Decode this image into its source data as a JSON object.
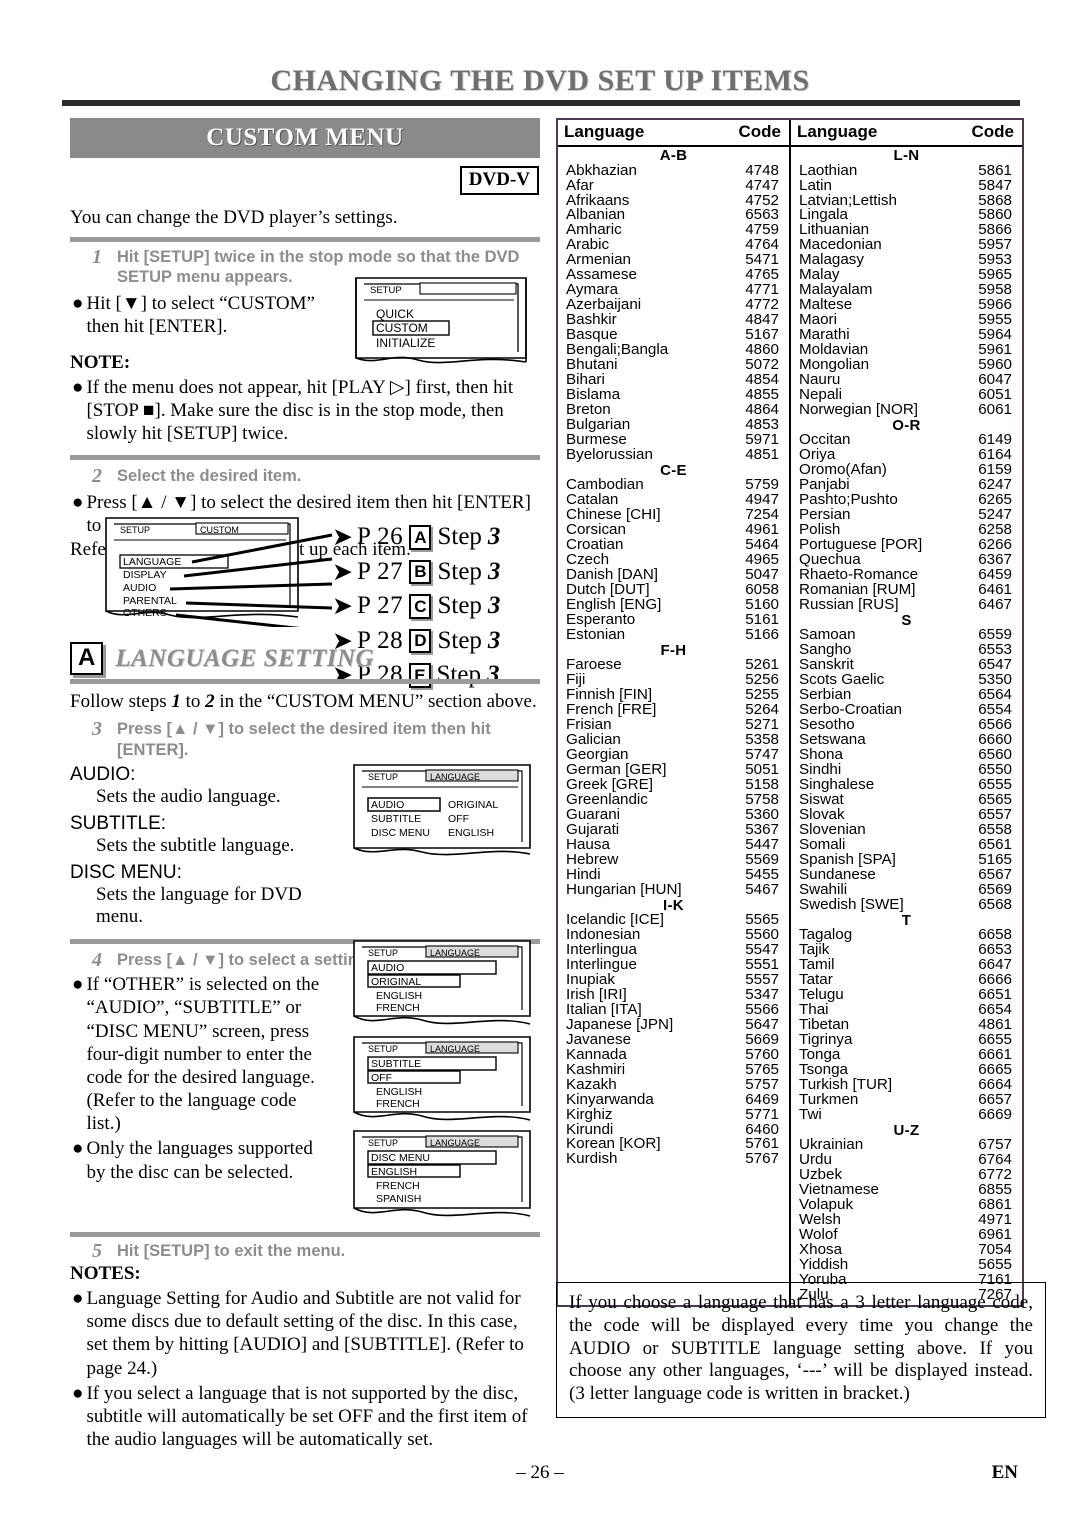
{
  "page": {
    "title": "CHANGING THE DVD SET UP ITEMS",
    "number": "– 26 –",
    "lang_mark": "EN"
  },
  "custom_menu": {
    "banner": "CUSTOM MENU",
    "badge": "DVD-V",
    "intro": "You can change the DVD player’s settings.",
    "step1": {
      "num": "1",
      "text": "Hit [SETUP] twice in the stop mode so that the DVD SETUP menu appears."
    },
    "bullet1": "Hit [▼] to select “CUSTOM” then hit [ENTER].",
    "note_heading": "NOTE:",
    "note1": "If the menu does not appear, hit [PLAY ▷] first, then hit [STOP ■]. Make sure the disc is in the stop mode, then slowly hit [SETUP] twice.",
    "step2": {
      "num": "2",
      "text": "Select the desired item."
    },
    "bullet2": "Press [▲ / ▼] to select the desired item then hit [ENTER] to confirm.",
    "refer": "Refer to the pages below to set up each item.",
    "osd_setup": {
      "header_left": "SETUP",
      "items": [
        "QUICK",
        "CUSTOM",
        "INITIALIZE"
      ],
      "highlighted": "CUSTOM"
    },
    "osd_custom": {
      "header_left": "SETUP",
      "header_right": "CUSTOM",
      "items": [
        "LANGUAGE",
        "DISPLAY",
        "AUDIO",
        "PARENTAL",
        "OTHERS"
      ],
      "highlighted": "LANGUAGE"
    },
    "page_refs": [
      {
        "page": "P 26",
        "letter": "A",
        "step": "Step",
        "num": "3"
      },
      {
        "page": "P 27",
        "letter": "B",
        "step": "Step",
        "num": "3"
      },
      {
        "page": "P 27",
        "letter": "C",
        "step": "Step",
        "num": "3"
      },
      {
        "page": "P 28",
        "letter": "D",
        "step": "Step",
        "num": "3"
      },
      {
        "page": "P 28",
        "letter": "E",
        "step": "Step",
        "num": "3"
      }
    ]
  },
  "language_setting": {
    "letter": "A",
    "title": "LANGUAGE SETTING",
    "follow": "Follow steps 1 to 2 in the “CUSTOM MENU” section above.",
    "follow_pre": "Follow steps ",
    "follow_n1": "1",
    "follow_mid": " to ",
    "follow_n2": "2",
    "follow_post": " in the “CUSTOM MENU” section above.",
    "step3": {
      "num": "3",
      "text": "Press [▲ / ▼] to select the desired item then hit [ENTER]."
    },
    "defs": [
      {
        "term": "AUDIO:",
        "desc": "Sets the audio language."
      },
      {
        "term": "SUBTITLE:",
        "desc": "Sets the subtitle language."
      },
      {
        "term": "DISC MENU:",
        "desc": "Sets the language for DVD menu."
      }
    ],
    "osd_language": {
      "header_left": "SETUP",
      "header_right": "LANGUAGE",
      "rows": [
        {
          "name": "AUDIO",
          "value": "ORIGINAL"
        },
        {
          "name": "SUBTITLE",
          "value": "OFF"
        },
        {
          "name": "DISC MENU",
          "value": "ENGLISH"
        }
      ],
      "highlighted": "AUDIO"
    },
    "step4": {
      "num": "4",
      "text": "Press [▲ / ▼] to select a setting then hit [ENTER]."
    },
    "bullet4a": "If “OTHER” is selected on the “AUDIO”, “SUBTITLE” or “DISC MENU” screen, press four-digit number to enter the code for the desired language. (Refer to the language code list.)",
    "bullet4b": "Only the languages supported by the disc can be selected.",
    "osd_audio": {
      "header_left": "SETUP",
      "header_right": "LANGUAGE",
      "title_row": "AUDIO",
      "items": [
        "ORIGINAL",
        "ENGLISH",
        "FRENCH"
      ],
      "highlighted": "ORIGINAL"
    },
    "osd_subtitle": {
      "header_left": "SETUP",
      "header_right": "LANGUAGE",
      "title_row": "SUBTITLE",
      "items": [
        "OFF",
        "ENGLISH",
        "FRENCH"
      ],
      "highlighted": "OFF"
    },
    "osd_discmenu": {
      "header_left": "SETUP",
      "header_right": "LANGUAGE",
      "title_row": "DISC MENU",
      "items": [
        "ENGLISH",
        "FRENCH",
        "SPANISH"
      ],
      "highlighted": "ENGLISH"
    },
    "step5": {
      "num": "5",
      "text": "Hit [SETUP] to exit the menu."
    },
    "notes_heading": "NOTES:",
    "note_a": "Language Setting for Audio and Subtitle are not valid for some discs due to default setting of the disc. In this case, set them by hitting [AUDIO] and [SUBTITLE]. (Refer to page 24.)",
    "note_b": "If you select a language that is not supported by the disc, subtitle will automatically be set OFF and the first item of the audio languages will be automatically set."
  },
  "code_table": {
    "headers": {
      "language": "Language",
      "code": "Code"
    },
    "left": [
      {
        "group": "A-B"
      },
      {
        "name": "Abkhazian",
        "code": "4748"
      },
      {
        "name": "Afar",
        "code": "4747"
      },
      {
        "name": "Afrikaans",
        "code": "4752"
      },
      {
        "name": "Albanian",
        "code": "6563"
      },
      {
        "name": "Amharic",
        "code": "4759"
      },
      {
        "name": "Arabic",
        "code": "4764"
      },
      {
        "name": "Armenian",
        "code": "5471"
      },
      {
        "name": "Assamese",
        "code": "4765"
      },
      {
        "name": "Aymara",
        "code": "4771"
      },
      {
        "name": "Azerbaijani",
        "code": "4772"
      },
      {
        "name": "Bashkir",
        "code": "4847"
      },
      {
        "name": "Basque",
        "code": "5167"
      },
      {
        "name": "Bengali;Bangla",
        "code": "4860"
      },
      {
        "name": "Bhutani",
        "code": "5072"
      },
      {
        "name": "Bihari",
        "code": "4854"
      },
      {
        "name": "Bislama",
        "code": "4855"
      },
      {
        "name": "Breton",
        "code": "4864"
      },
      {
        "name": "Bulgarian",
        "code": "4853"
      },
      {
        "name": "Burmese",
        "code": "5971"
      },
      {
        "name": "Byelorussian",
        "code": "4851"
      },
      {
        "group": "C-E"
      },
      {
        "name": "Cambodian",
        "code": "5759"
      },
      {
        "name": "Catalan",
        "code": "4947"
      },
      {
        "name": "Chinese [CHI]",
        "code": "7254"
      },
      {
        "name": "Corsican",
        "code": "4961"
      },
      {
        "name": "Croatian",
        "code": "5464"
      },
      {
        "name": "Czech",
        "code": "4965"
      },
      {
        "name": "Danish [DAN]",
        "code": "5047"
      },
      {
        "name": "Dutch [DUT]",
        "code": "6058"
      },
      {
        "name": "English [ENG]",
        "code": "5160"
      },
      {
        "name": "Esperanto",
        "code": "5161"
      },
      {
        "name": "Estonian",
        "code": "5166"
      },
      {
        "group": "F-H"
      },
      {
        "name": "Faroese",
        "code": "5261"
      },
      {
        "name": "Fiji",
        "code": "5256"
      },
      {
        "name": "Finnish [FIN]",
        "code": "5255"
      },
      {
        "name": "French [FRE]",
        "code": "5264"
      },
      {
        "name": "Frisian",
        "code": "5271"
      },
      {
        "name": "Galician",
        "code": "5358"
      },
      {
        "name": "Georgian",
        "code": "5747"
      },
      {
        "name": "German [GER]",
        "code": "5051"
      },
      {
        "name": "Greek [GRE]",
        "code": "5158"
      },
      {
        "name": "Greenlandic",
        "code": "5758"
      },
      {
        "name": "Guarani",
        "code": "5360"
      },
      {
        "name": "Gujarati",
        "code": "5367"
      },
      {
        "name": "Hausa",
        "code": "5447"
      },
      {
        "name": "Hebrew",
        "code": "5569"
      },
      {
        "name": "Hindi",
        "code": "5455"
      },
      {
        "name": "Hungarian [HUN]",
        "code": "5467"
      },
      {
        "group": "I-K"
      },
      {
        "name": "Icelandic [ICE]",
        "code": "5565"
      },
      {
        "name": "Indonesian",
        "code": "5560"
      },
      {
        "name": "Interlingua",
        "code": "5547"
      },
      {
        "name": "Interlingue",
        "code": "5551"
      },
      {
        "name": "Inupiak",
        "code": "5557"
      },
      {
        "name": "Irish [IRI]",
        "code": "5347"
      },
      {
        "name": "Italian [ITA]",
        "code": "5566"
      },
      {
        "name": "Japanese [JPN]",
        "code": "5647"
      },
      {
        "name": "Javanese",
        "code": "5669"
      },
      {
        "name": "Kannada",
        "code": "5760"
      },
      {
        "name": "Kashmiri",
        "code": "5765"
      },
      {
        "name": "Kazakh",
        "code": "5757"
      },
      {
        "name": "Kinyarwanda",
        "code": "6469"
      },
      {
        "name": "Kirghiz",
        "code": "5771"
      },
      {
        "name": "Kirundi",
        "code": "6460"
      },
      {
        "name": "Korean [KOR]",
        "code": "5761"
      },
      {
        "name": "Kurdish",
        "code": "5767"
      }
    ],
    "right": [
      {
        "group": "L-N"
      },
      {
        "name": "Laothian",
        "code": "5861"
      },
      {
        "name": "Latin",
        "code": "5847"
      },
      {
        "name": "Latvian;Lettish",
        "code": "5868"
      },
      {
        "name": "Lingala",
        "code": "5860"
      },
      {
        "name": "Lithuanian",
        "code": "5866"
      },
      {
        "name": "Macedonian",
        "code": "5957"
      },
      {
        "name": "Malagasy",
        "code": "5953"
      },
      {
        "name": "Malay",
        "code": "5965"
      },
      {
        "name": "Malayalam",
        "code": "5958"
      },
      {
        "name": "Maltese",
        "code": "5966"
      },
      {
        "name": "Maori",
        "code": "5955"
      },
      {
        "name": "Marathi",
        "code": "5964"
      },
      {
        "name": "Moldavian",
        "code": "5961"
      },
      {
        "name": "Mongolian",
        "code": "5960"
      },
      {
        "name": "Nauru",
        "code": "6047"
      },
      {
        "name": "Nepali",
        "code": "6051"
      },
      {
        "name": "Norwegian [NOR]",
        "code": "6061"
      },
      {
        "group": "O-R"
      },
      {
        "name": "Occitan",
        "code": "6149"
      },
      {
        "name": "Oriya",
        "code": "6164"
      },
      {
        "name": "Oromo(Afan)",
        "code": "6159"
      },
      {
        "name": "Panjabi",
        "code": "6247"
      },
      {
        "name": "Pashto;Pushto",
        "code": "6265"
      },
      {
        "name": "Persian",
        "code": "5247"
      },
      {
        "name": "Polish",
        "code": "6258"
      },
      {
        "name": "Portuguese [POR]",
        "code": "6266"
      },
      {
        "name": "Quechua",
        "code": "6367"
      },
      {
        "name": "Rhaeto-Romance",
        "code": "6459"
      },
      {
        "name": "Romanian [RUM]",
        "code": "6461"
      },
      {
        "name": "Russian [RUS]",
        "code": "6467"
      },
      {
        "group": "S"
      },
      {
        "name": "Samoan",
        "code": "6559"
      },
      {
        "name": "Sangho",
        "code": "6553"
      },
      {
        "name": "Sanskrit",
        "code": "6547"
      },
      {
        "name": "Scots Gaelic",
        "code": "5350"
      },
      {
        "name": "Serbian",
        "code": "6564"
      },
      {
        "name": "Serbo-Croatian",
        "code": "6554"
      },
      {
        "name": "Sesotho",
        "code": "6566"
      },
      {
        "name": "Setswana",
        "code": "6660"
      },
      {
        "name": "Shona",
        "code": "6560"
      },
      {
        "name": "Sindhi",
        "code": "6550"
      },
      {
        "name": "Singhalese",
        "code": "6555"
      },
      {
        "name": "Siswat",
        "code": "6565"
      },
      {
        "name": "Slovak",
        "code": "6557"
      },
      {
        "name": "Slovenian",
        "code": "6558"
      },
      {
        "name": "Somali",
        "code": "6561"
      },
      {
        "name": "Spanish [SPA]",
        "code": "5165"
      },
      {
        "name": "Sundanese",
        "code": "6567"
      },
      {
        "name": "Swahili",
        "code": "6569"
      },
      {
        "name": "Swedish [SWE]",
        "code": "6568"
      },
      {
        "group": "T"
      },
      {
        "name": "Tagalog",
        "code": "6658"
      },
      {
        "name": "Tajik",
        "code": "6653"
      },
      {
        "name": "Tamil",
        "code": "6647"
      },
      {
        "name": "Tatar",
        "code": "6666"
      },
      {
        "name": "Telugu",
        "code": "6651"
      },
      {
        "name": "Thai",
        "code": "6654"
      },
      {
        "name": "Tibetan",
        "code": "4861"
      },
      {
        "name": "Tigrinya",
        "code": "6655"
      },
      {
        "name": "Tonga",
        "code": "6661"
      },
      {
        "name": "Tsonga",
        "code": "6665"
      },
      {
        "name": "Turkish [TUR]",
        "code": "6664"
      },
      {
        "name": "Turkmen",
        "code": "6657"
      },
      {
        "name": "Twi",
        "code": "6669"
      },
      {
        "group": "U-Z"
      },
      {
        "name": "Ukrainian",
        "code": "6757"
      },
      {
        "name": "Urdu",
        "code": "6764"
      },
      {
        "name": "Uzbek",
        "code": "6772"
      },
      {
        "name": "Vietnamese",
        "code": "6855"
      },
      {
        "name": "Volapuk",
        "code": "6861"
      },
      {
        "name": "Welsh",
        "code": "4971"
      },
      {
        "name": "Wolof",
        "code": "6961"
      },
      {
        "name": "Xhosa",
        "code": "7054"
      },
      {
        "name": "Yiddish",
        "code": "5655"
      },
      {
        "name": "Yoruba",
        "code": "7161"
      },
      {
        "name": "Zulu",
        "code": "7267"
      }
    ]
  },
  "info_box": {
    "text": "If you choose a language that has a 3 letter language code, the code will be displayed every time you change the AUDIO or SUBTITLE language setting above. If you choose any other languages, ‘---’ will be displayed instead. (3 letter language code is written in bracket.)"
  }
}
